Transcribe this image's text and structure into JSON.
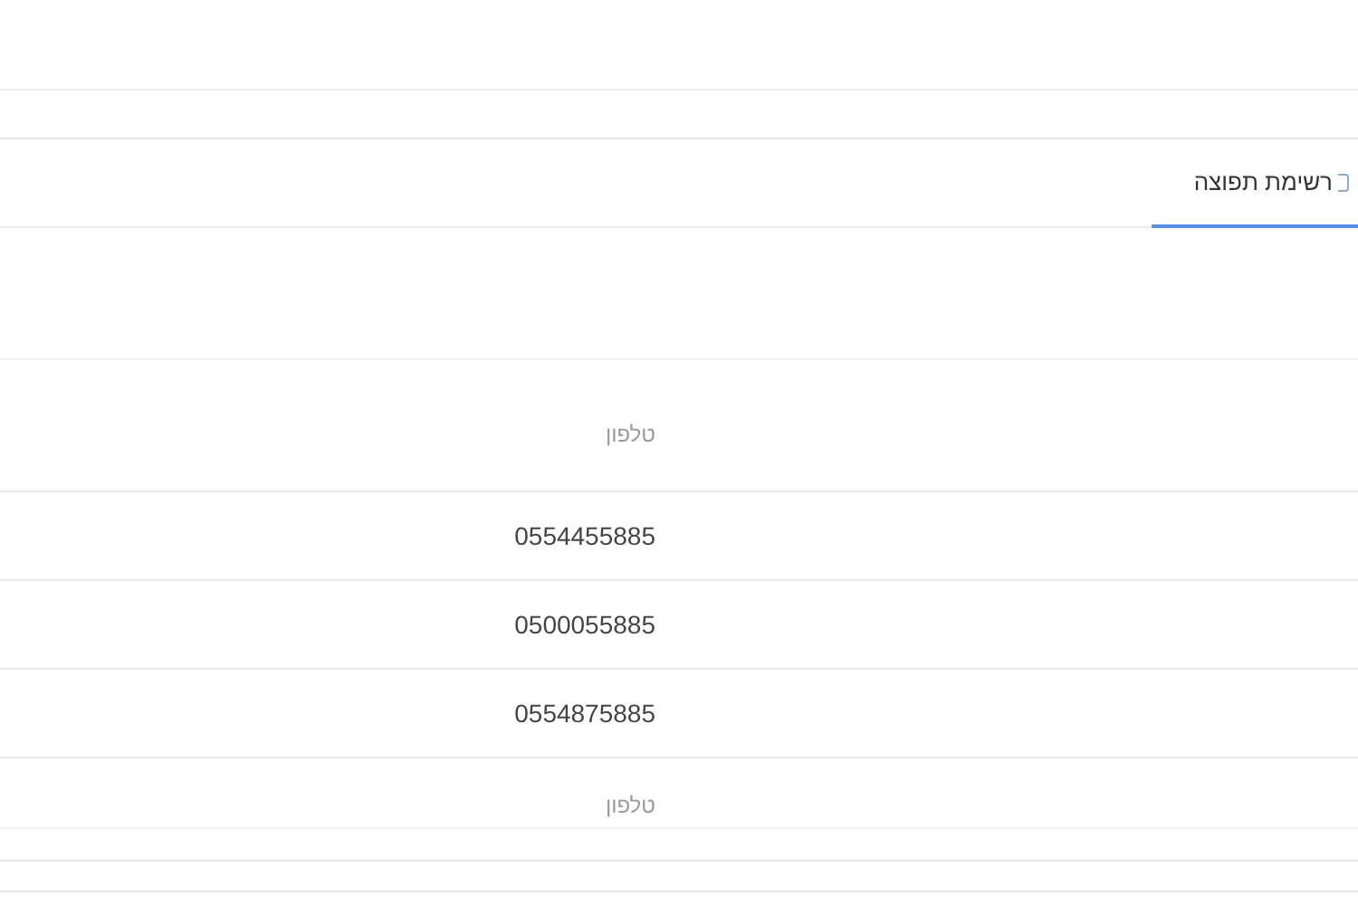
{
  "tabs": [
    {
      "label": "רשימת תפוצה",
      "selected": true
    }
  ],
  "table": {
    "columns": [
      "טלפון"
    ],
    "rows": [
      {
        "phone": "0554455885"
      },
      {
        "phone": "0500055885"
      },
      {
        "phone": "0554875885"
      }
    ],
    "footer": [
      "טלפון"
    ]
  }
}
